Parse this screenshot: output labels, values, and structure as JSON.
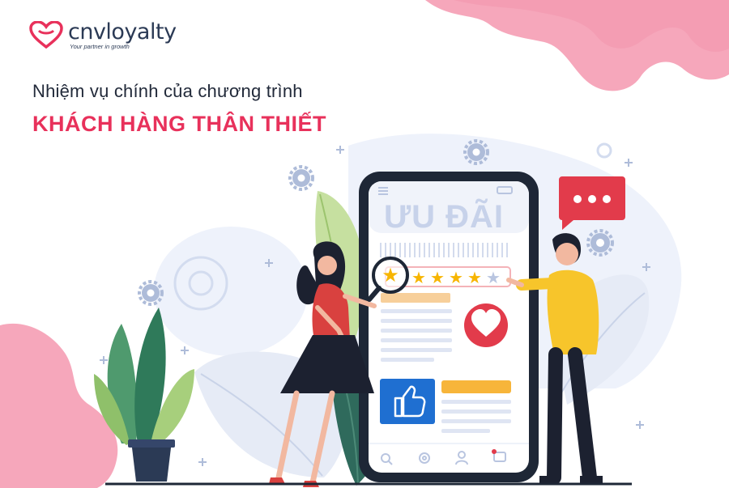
{
  "brand": {
    "name": "cnvloyalty",
    "tagline": "Your partner in growth",
    "accent": "#e8315b",
    "navy": "#2b3a55"
  },
  "headline": {
    "subtitle": "Nhiệm vụ chính của chương trình",
    "title": "KHÁCH HÀNG THÂN THIẾT"
  },
  "phone": {
    "banner_text": "ƯU ĐÃI",
    "rating_stars": 5,
    "rating_filled": 4,
    "icons": [
      "search-icon",
      "gear-icon",
      "user-icon",
      "chat-icon"
    ]
  },
  "colors": {
    "pink_blob": "#f4a3b8",
    "star": "#f7b500",
    "heart_badge": "#e23b4b",
    "thumb_box": "#1f6fd1",
    "man_shirt": "#f7c52b",
    "woman_top": "#d9413f"
  }
}
